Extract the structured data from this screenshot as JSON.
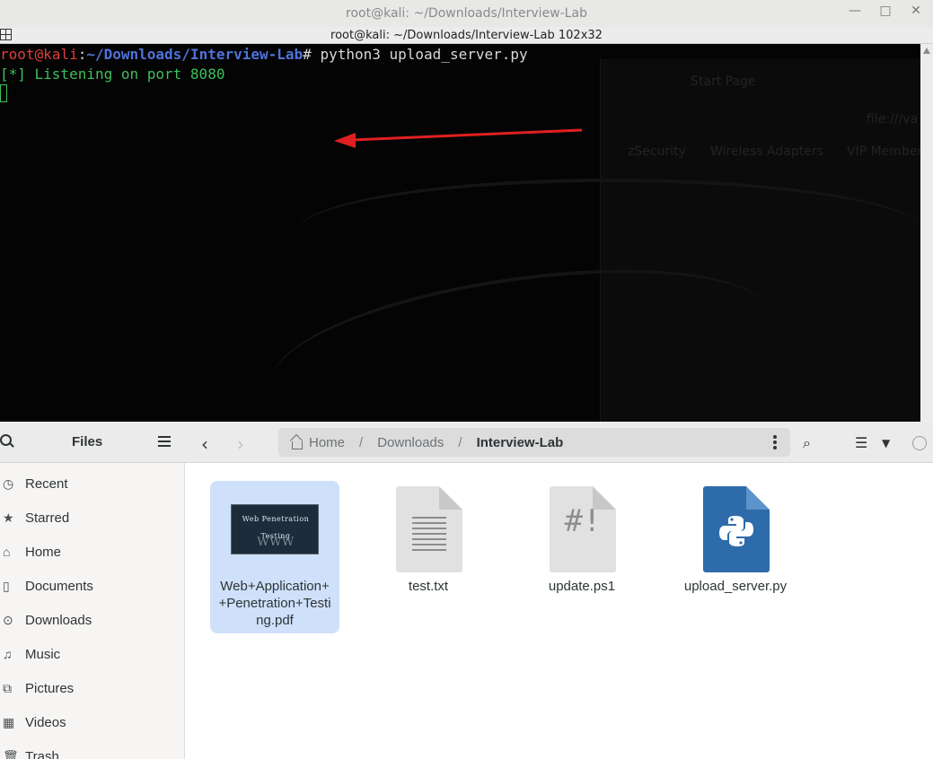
{
  "terminal": {
    "window_title": "root@kali: ~/Downloads/Interview-Lab",
    "tab_title": "root@kali: ~/Downloads/Interview-Lab 102x32",
    "prompt_user": "root@kali",
    "prompt_sep": ":",
    "prompt_path": "~/Downloads/Interview-Lab",
    "prompt_symbol": "#",
    "command": " python3 upload_server.py",
    "output": "[*] Listening on port 8080",
    "minimize_glyph": "—",
    "maximize_glyph": "□",
    "close_glyph": "✕"
  },
  "background_window": {
    "tab": "Start Page",
    "url": "file:///va",
    "bookmarks": [
      "zSecurity",
      "Wireless Adapters",
      "VIP Member"
    ]
  },
  "annotation": {
    "arrow_color": "#e02020"
  },
  "files": {
    "sidebar_title": "Files",
    "sidebar_items": [
      {
        "label": "Recent",
        "icon": "clock-icon"
      },
      {
        "label": "Starred",
        "icon": "star-icon"
      },
      {
        "label": "Home",
        "icon": "home-icon"
      },
      {
        "label": "Documents",
        "icon": "document-icon"
      },
      {
        "label": "Downloads",
        "icon": "download-icon"
      },
      {
        "label": "Music",
        "icon": "music-icon"
      },
      {
        "label": "Pictures",
        "icon": "picture-icon"
      },
      {
        "label": "Videos",
        "icon": "video-icon"
      },
      {
        "label": "Trash",
        "icon": "trash-icon"
      }
    ],
    "breadcrumb": [
      "Home",
      "Downloads",
      "Interview-Lab"
    ],
    "items": [
      {
        "name": "Web+Application+\n+Penetration+Testi\nng.pdf",
        "type": "pdf",
        "thumb_title": "Web Penetration Testing",
        "thumb_sub": "WWW"
      },
      {
        "name": "test.txt",
        "type": "text"
      },
      {
        "name": "update.ps1",
        "type": "script",
        "glyph": "#!"
      },
      {
        "name": "upload_server.py",
        "type": "python"
      }
    ]
  }
}
